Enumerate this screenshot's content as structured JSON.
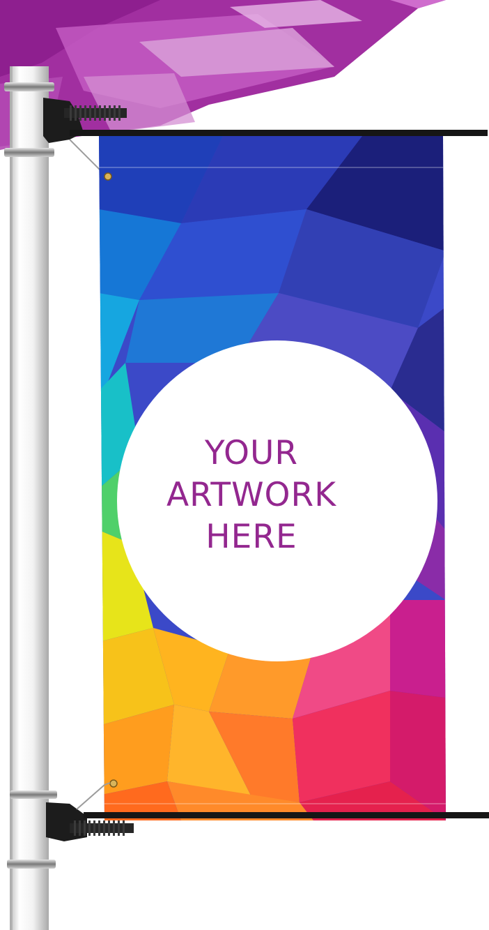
{
  "banner": {
    "headline_lines": [
      "YOUR",
      "ARTWORK",
      "HERE"
    ]
  },
  "colors": {
    "accent": "#93278f",
    "header_purple": "#a93aa8",
    "pole": "#f1f1f1",
    "hardware": "#1a1a1a"
  },
  "icons": {
    "pole": "street-pole",
    "brackets": "banner-bracket",
    "banner": "polygon-banner"
  }
}
